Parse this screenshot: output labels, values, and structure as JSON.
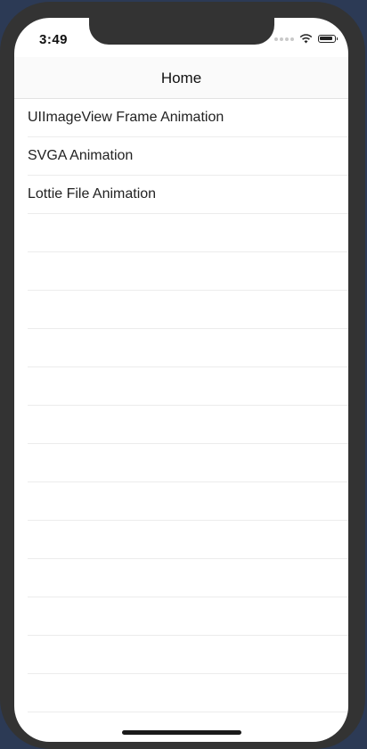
{
  "status_bar": {
    "time": "3:49",
    "wifi_icon": "wifi-icon",
    "battery_icon": "battery-icon"
  },
  "navbar": {
    "title": "Home"
  },
  "list": {
    "items": [
      {
        "label": "UIImageView Frame Animation"
      },
      {
        "label": "SVGA Animation"
      },
      {
        "label": "Lottie File Animation"
      }
    ],
    "empty_rows": 13
  },
  "colors": {
    "frame": "#333333",
    "screen": "#ffffff",
    "separator": "#ececec"
  }
}
